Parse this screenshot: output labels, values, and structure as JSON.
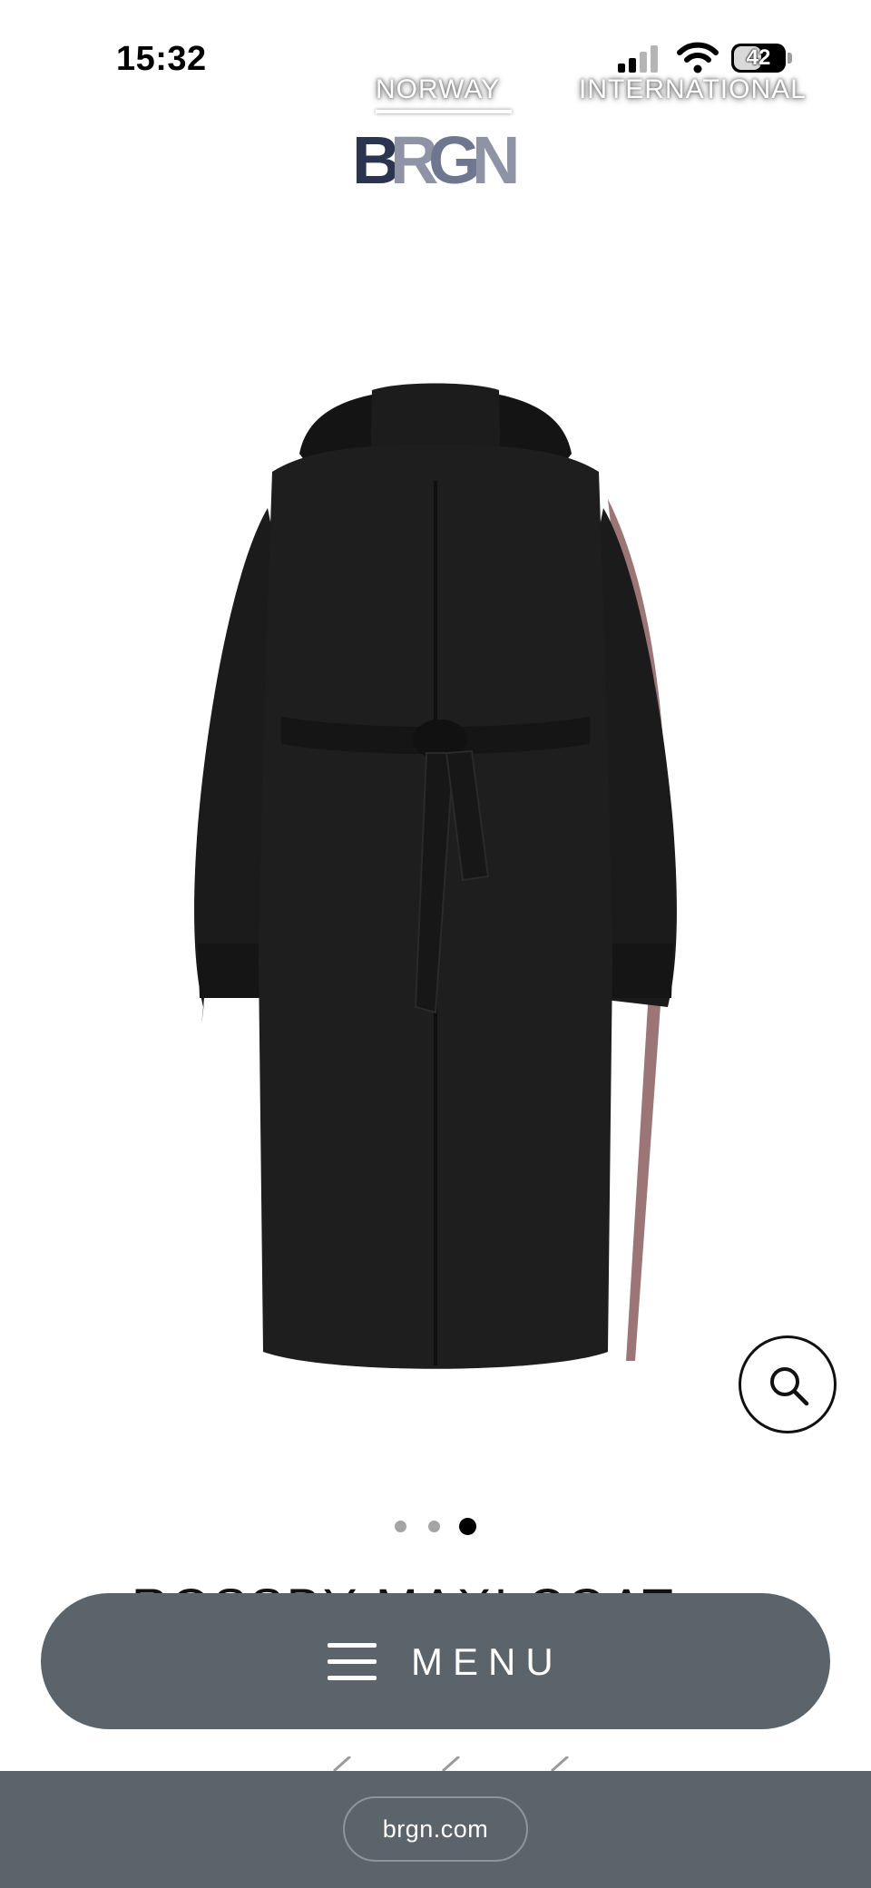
{
  "status_bar": {
    "time": "15:32",
    "battery_level": "42",
    "icons": [
      "signal-icon",
      "wifi-icon",
      "battery-icon"
    ]
  },
  "header": {
    "regions": [
      {
        "label": "NORWAY",
        "selected": true
      },
      {
        "label": "INTERNATIONAL",
        "selected": false
      }
    ],
    "logo_text": "BRGN"
  },
  "product": {
    "image_icon": "coat-image",
    "title": "ROSSBY MAXI COAT",
    "carousel": {
      "count": 3,
      "active_index": 2
    }
  },
  "actions": {
    "zoom_icon": "search-icon",
    "menu_label": "MENU",
    "menu_icon": "hamburger-icon"
  },
  "browser": {
    "url": "brgn.com"
  },
  "colors": {
    "menu_background": "#5b636b",
    "logo_dark": "#2b3550",
    "logo_light": "#8e93a6"
  }
}
